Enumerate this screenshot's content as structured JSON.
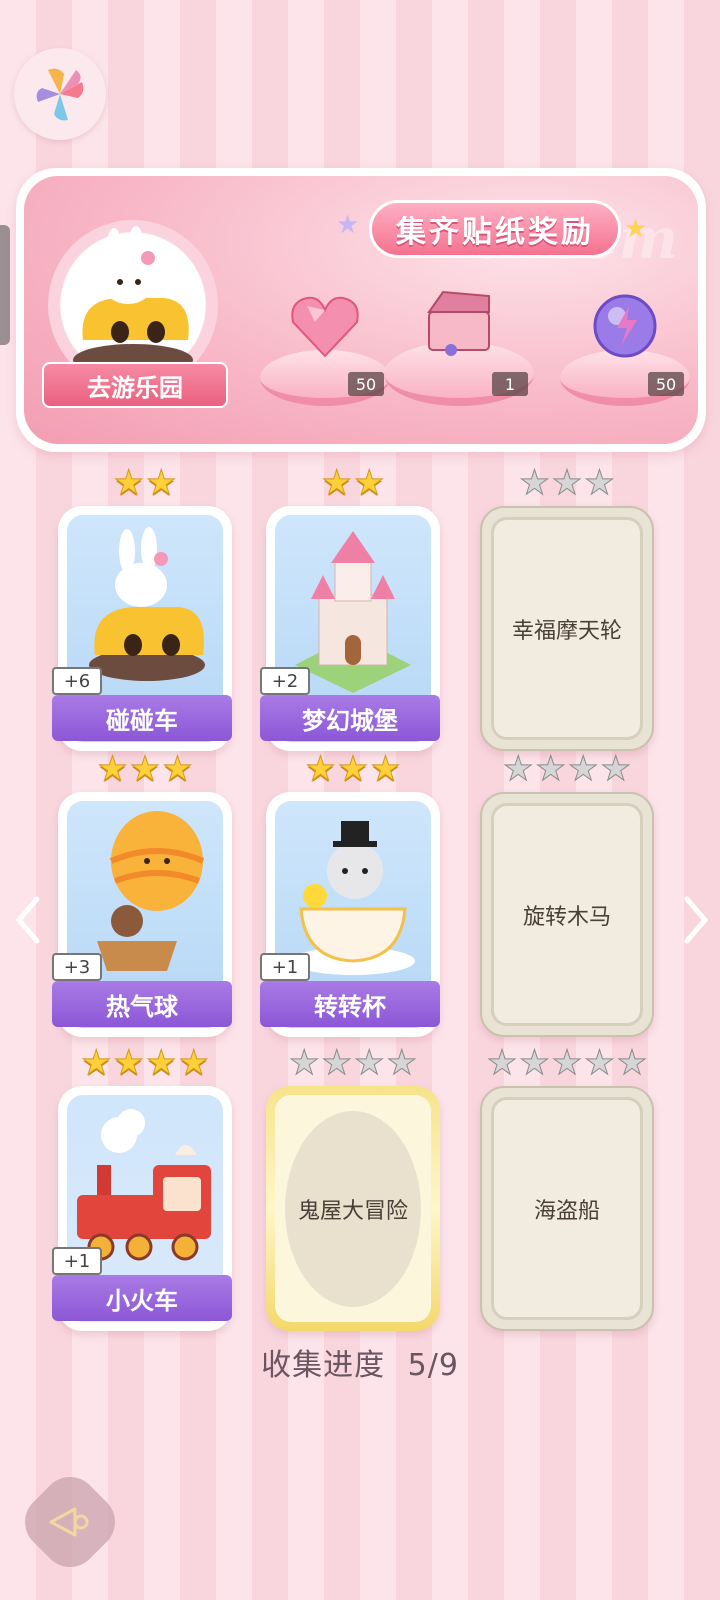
{
  "banner": {
    "title": "集齐贴纸奖励",
    "watermark": "Redeem",
    "portrait_label": "去游乐园",
    "rewards": [
      {
        "icon": "pink-heart-gem-icon",
        "count": "50"
      },
      {
        "icon": "gift-box-icon",
        "count": "1"
      },
      {
        "icon": "purple-lightning-orb-icon",
        "count": "50"
      }
    ]
  },
  "cards": [
    {
      "name": "碰碰车",
      "plus": "+6",
      "stars": 2,
      "max_stars": 2,
      "state": "collected"
    },
    {
      "name": "梦幻城堡",
      "plus": "+2",
      "stars": 2,
      "max_stars": 2,
      "state": "collected"
    },
    {
      "name": "幸福摩天轮",
      "stars": 0,
      "max_stars": 3,
      "state": "locked"
    },
    {
      "name": "热气球",
      "plus": "+3",
      "stars": 3,
      "max_stars": 3,
      "state": "collected"
    },
    {
      "name": "转转杯",
      "plus": "+1",
      "stars": 3,
      "max_stars": 3,
      "state": "collected"
    },
    {
      "name": "旋转木马",
      "stars": 0,
      "max_stars": 4,
      "state": "locked"
    },
    {
      "name": "小火车",
      "plus": "+1",
      "stars": 4,
      "max_stars": 4,
      "state": "collected"
    },
    {
      "name": "鬼屋大冒险",
      "stars": 0,
      "max_stars": 4,
      "state": "locked-gold"
    },
    {
      "name": "海盗船",
      "stars": 0,
      "max_stars": 5,
      "state": "locked"
    }
  ],
  "progress": {
    "label": "收集进度",
    "value": "5/9"
  },
  "colors": {
    "accent_pink": "#f4728f",
    "label_purple": "#8c57d6",
    "star_gold": "#ffd03a",
    "star_gray": "#d6d6d6"
  }
}
